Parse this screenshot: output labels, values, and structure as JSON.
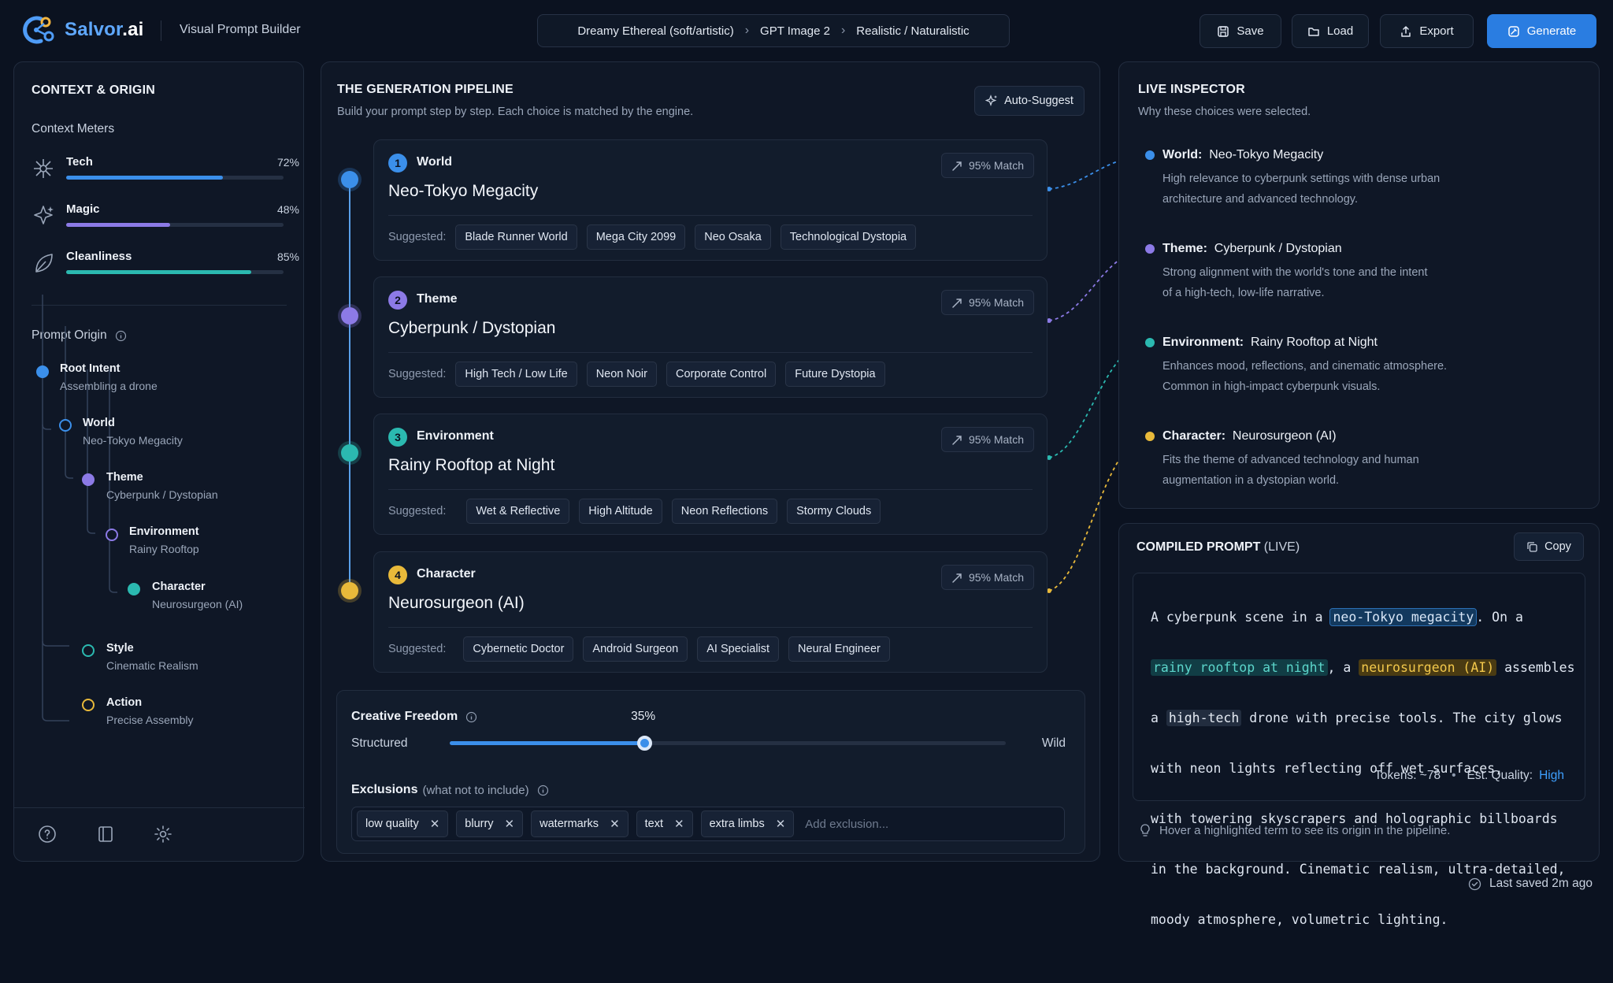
{
  "app": {
    "logo_text": "Salvor",
    "logo_suffix": ".ai",
    "subtitle": "Visual Prompt Builder"
  },
  "breadcrumb": [
    "Dreamy Ethereal (soft/artistic)",
    "GPT Image 2",
    "Realistic / Naturalistic"
  ],
  "toolbar": {
    "save": "Save",
    "load": "Load",
    "export": "Export",
    "generate": "Generate"
  },
  "context": {
    "title": "CONTEXT & ORIGIN",
    "meters_title": "Context Meters",
    "meters": [
      {
        "label": "Tech",
        "value_text": "72%",
        "value": 0.72,
        "color": "#3b8fea",
        "icon": "circuit-icon"
      },
      {
        "label": "Magic",
        "value_text": "48%",
        "value": 0.48,
        "color": "#8c7ae6",
        "icon": "sparkle-icon"
      },
      {
        "label": "Cleanliness",
        "value_text": "85%",
        "value": 0.85,
        "color": "#2bb9b0",
        "icon": "leaf-icon"
      }
    ],
    "origin_title": "Prompt Origin",
    "tree": [
      {
        "name": "Root Intent",
        "sub": "Assembling a drone"
      },
      {
        "name": "World",
        "sub": "Neo-Tokyo Megacity"
      },
      {
        "name": "Theme",
        "sub": "Cyberpunk / Dystopian"
      },
      {
        "name": "Environment",
        "sub": "Rainy Rooftop"
      },
      {
        "name": "Character",
        "sub": "Neurosurgeon (AI)"
      },
      {
        "name": "Style",
        "sub": "Cinematic Realism"
      },
      {
        "name": "Action",
        "sub": "Precise Assembly"
      }
    ]
  },
  "pipeline": {
    "title": "THE GENERATION PIPELINE",
    "subtitle": "Build your prompt step by step. Each choice is matched by the engine.",
    "auto_suggest": "Auto-Suggest",
    "suggested_label": "Suggested:",
    "steps": [
      {
        "num": "1",
        "title": "World",
        "value": "Neo-Tokyo Megacity",
        "match": "95% Match",
        "color": "#3b8fea",
        "suggestions": [
          "Blade Runner World",
          "Mega City 2099",
          "Neo Osaka",
          "Technological Dystopia"
        ]
      },
      {
        "num": "2",
        "title": "Theme",
        "value": "Cyberpunk / Dystopian",
        "match": "95% Match",
        "color": "#8c7ae6",
        "suggestions": [
          "High Tech / Low Life",
          "Neon Noir",
          "Corporate Control",
          "Future Dystopia"
        ]
      },
      {
        "num": "3",
        "title": "Environment",
        "value": "Rainy Rooftop at Night",
        "match": "95% Match",
        "color": "#2bb9b0",
        "suggestions": [
          "Wet & Reflective",
          "High Altitude",
          "Neon Reflections",
          "Stormy Clouds"
        ]
      },
      {
        "num": "4",
        "title": "Character",
        "value": "Neurosurgeon (AI)",
        "match": "95% Match",
        "color": "#e8b93a",
        "suggestions": [
          "Cybernetic Doctor",
          "Android Surgeon",
          "AI Specialist",
          "Neural Engineer"
        ]
      }
    ],
    "freedom": {
      "title": "Creative Freedom",
      "value_text": "35%",
      "value": 0.35,
      "left": "Structured",
      "right": "Wild"
    },
    "exclusions": {
      "title": "Exclusions",
      "hint": "(what not to include)",
      "items": [
        "low quality",
        "blurry",
        "watermarks",
        "text",
        "extra limbs"
      ],
      "placeholder": "Add exclusion..."
    }
  },
  "inspector": {
    "title": "LIVE INSPECTOR",
    "subtitle": "Why these choices were selected.",
    "items": [
      {
        "key": "World:",
        "value": "Neo-Tokyo Megacity",
        "color": "#3b8fea",
        "lines": [
          "High relevance to cyberpunk settings with dense urban",
          "architecture and advanced technology."
        ]
      },
      {
        "key": "Theme:",
        "value": "Cyberpunk / Dystopian",
        "color": "#8c7ae6",
        "lines": [
          "Strong alignment with the world's tone and the intent",
          "of a high-tech, low-life narrative."
        ]
      },
      {
        "key": "Environment:",
        "value": "Rainy Rooftop at Night",
        "color": "#2bb9b0",
        "lines": [
          "Enhances mood, reflections, and cinematic atmosphere.",
          "Common in high-impact cyberpunk visuals."
        ]
      },
      {
        "key": "Character:",
        "value": "Neurosurgeon (AI)",
        "color": "#e8b93a",
        "lines": [
          "Fits the theme of advanced technology and human",
          "augmentation in a dystopian world."
        ]
      }
    ]
  },
  "compiled": {
    "title": "COMPILED PROMPT",
    "live": "(LIVE)",
    "copy": "Copy",
    "lines": [
      [
        "A cyberpunk scene in a ",
        "neo-Tokyo megacity",
        ". On a"
      ],
      [
        "",
        "rainy rooftop at night",
        ", a ",
        "neurosurgeon (AI)",
        " assembles"
      ],
      [
        "a ",
        "high-tech",
        " drone with precise tools. The city glows"
      ],
      [
        "with neon lights reflecting off wet surfaces,"
      ],
      [
        "with towering skyscrapers and holographic billboards"
      ],
      [
        "in the background. Cinematic realism, ultra-detailed,"
      ],
      [
        "moody atmosphere, volumetric lighting."
      ]
    ],
    "tokens": "Tokens: ~78",
    "quality_label": "Est. Quality:",
    "quality_value": "High",
    "hint": "Hover a highlighted term to see its origin in the pipeline."
  },
  "footer": {
    "saved": "Last saved 2m ago"
  }
}
